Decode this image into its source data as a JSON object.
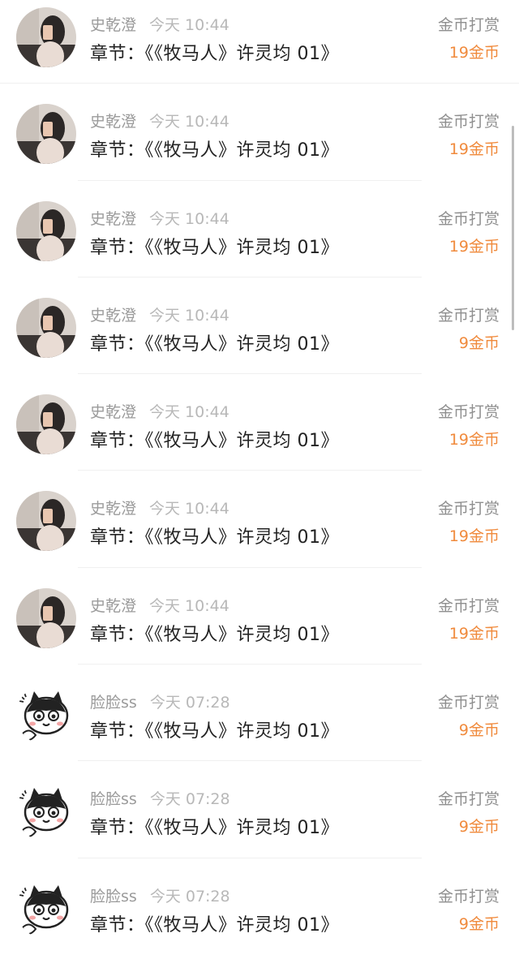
{
  "items": [
    {
      "avatar": "photo-avatar",
      "username": "史乾澄",
      "time": "今天 10:44",
      "chapter": "章节：《《牧马人》许灵均 01》",
      "tip_label": "金币打赏",
      "tip_amount": "19金币"
    },
    {
      "avatar": "photo-avatar",
      "username": "史乾澄",
      "time": "今天 10:44",
      "chapter": "章节：《《牧马人》许灵均 01》",
      "tip_label": "金币打赏",
      "tip_amount": "19金币"
    },
    {
      "avatar": "photo-avatar",
      "username": "史乾澄",
      "time": "今天 10:44",
      "chapter": "章节：《《牧马人》许灵均 01》",
      "tip_label": "金币打赏",
      "tip_amount": "19金币"
    },
    {
      "avatar": "photo-avatar",
      "username": "史乾澄",
      "time": "今天 10:44",
      "chapter": "章节：《《牧马人》许灵均 01》",
      "tip_label": "金币打赏",
      "tip_amount": "9金币"
    },
    {
      "avatar": "photo-avatar",
      "username": "史乾澄",
      "time": "今天 10:44",
      "chapter": "章节：《《牧马人》许灵均 01》",
      "tip_label": "金币打赏",
      "tip_amount": "19金币"
    },
    {
      "avatar": "photo-avatar",
      "username": "史乾澄",
      "time": "今天 10:44",
      "chapter": "章节：《《牧马人》许灵均 01》",
      "tip_label": "金币打赏",
      "tip_amount": "19金币"
    },
    {
      "avatar": "photo-avatar",
      "username": "史乾澄",
      "time": "今天 10:44",
      "chapter": "章节：《《牧马人》许灵均 01》",
      "tip_label": "金币打赏",
      "tip_amount": "19金币"
    },
    {
      "avatar": "cat-avatar",
      "username": "脸脸ss",
      "time": "今天 07:28",
      "chapter": "章节：《《牧马人》许灵均 01》",
      "tip_label": "金币打赏",
      "tip_amount": "9金币"
    },
    {
      "avatar": "cat-avatar",
      "username": "脸脸ss",
      "time": "今天 07:28",
      "chapter": "章节：《《牧马人》许灵均 01》",
      "tip_label": "金币打赏",
      "tip_amount": "9金币"
    },
    {
      "avatar": "cat-avatar",
      "username": "脸脸ss",
      "time": "今天 07:28",
      "chapter": "章节：《《牧马人》许灵均 01》",
      "tip_label": "金币打赏",
      "tip_amount": "9金币"
    }
  ],
  "colors": {
    "tip_amount": "#f08a3c",
    "username": "#9b9b9b",
    "chapter": "#222222"
  }
}
